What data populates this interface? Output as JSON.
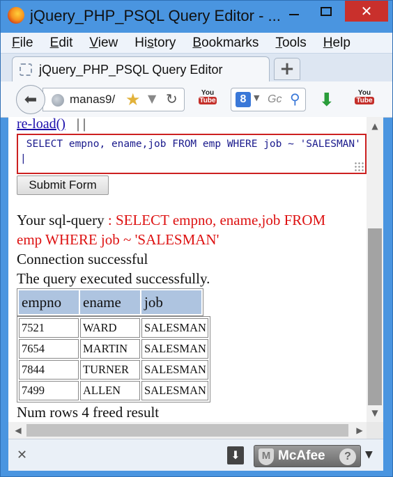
{
  "window": {
    "title": "jQuery_PHP_PSQL Query Editor - ...",
    "close_glyph": "✕"
  },
  "menubar": {
    "items": [
      {
        "accel": "F",
        "rest": "ile"
      },
      {
        "accel": "E",
        "rest": "dit"
      },
      {
        "accel": "V",
        "rest": "iew"
      },
      {
        "pre": "Hi",
        "accel": "s",
        "rest": "tory"
      },
      {
        "accel": "B",
        "rest": "ookmarks"
      },
      {
        "accel": "T",
        "rest": "ools"
      },
      {
        "accel": "H",
        "rest": "elp"
      }
    ]
  },
  "tabs": {
    "active_label": "jQuery_PHP_PSQL Query Editor",
    "new_tab_glyph": "+"
  },
  "navbar": {
    "url_text": "manas9/",
    "youtube_top": "You",
    "youtube_bottom": "Tube",
    "search_engine_glyph": "8",
    "search_placeholder": "Gc"
  },
  "page": {
    "reload_link": "re-load()",
    "reload_separator": "| |",
    "sql_textarea_value": " SELECT empno, ename,job FROM emp WHERE job ~ 'SALESMAN' |",
    "submit_label": "Submit Form",
    "sql_prefix": "Your sql-query ",
    "sql_query_text": ": SELECT empno, ename,job FROM emp WHERE job ~ 'SALESMAN'",
    "status_connection": "Connection successful",
    "status_query": "The query executed successfully.",
    "table_headers": [
      "empno",
      "ename",
      "job"
    ],
    "table_rows": [
      [
        "7521",
        "WARD",
        "SALESMAN"
      ],
      [
        "7654",
        "MARTIN",
        "SALESMAN"
      ],
      [
        "7844",
        "TURNER",
        "SALESMAN"
      ],
      [
        "7499",
        "ALLEN",
        "SALESMAN"
      ]
    ],
    "footer": "Num rows 4 freed result"
  },
  "addonbar": {
    "close_glyph": "✕",
    "mcafee_label": "McAfee",
    "mcafee_help": "?",
    "menu_glyph": "▼"
  },
  "colors": {
    "titlebar": "#4a95e0",
    "close_button": "#c9302c",
    "textarea_border": "#cc2020",
    "query_text": "#dd1111",
    "link": "#1a0dab",
    "table_header_bg": "#aec4e0"
  }
}
